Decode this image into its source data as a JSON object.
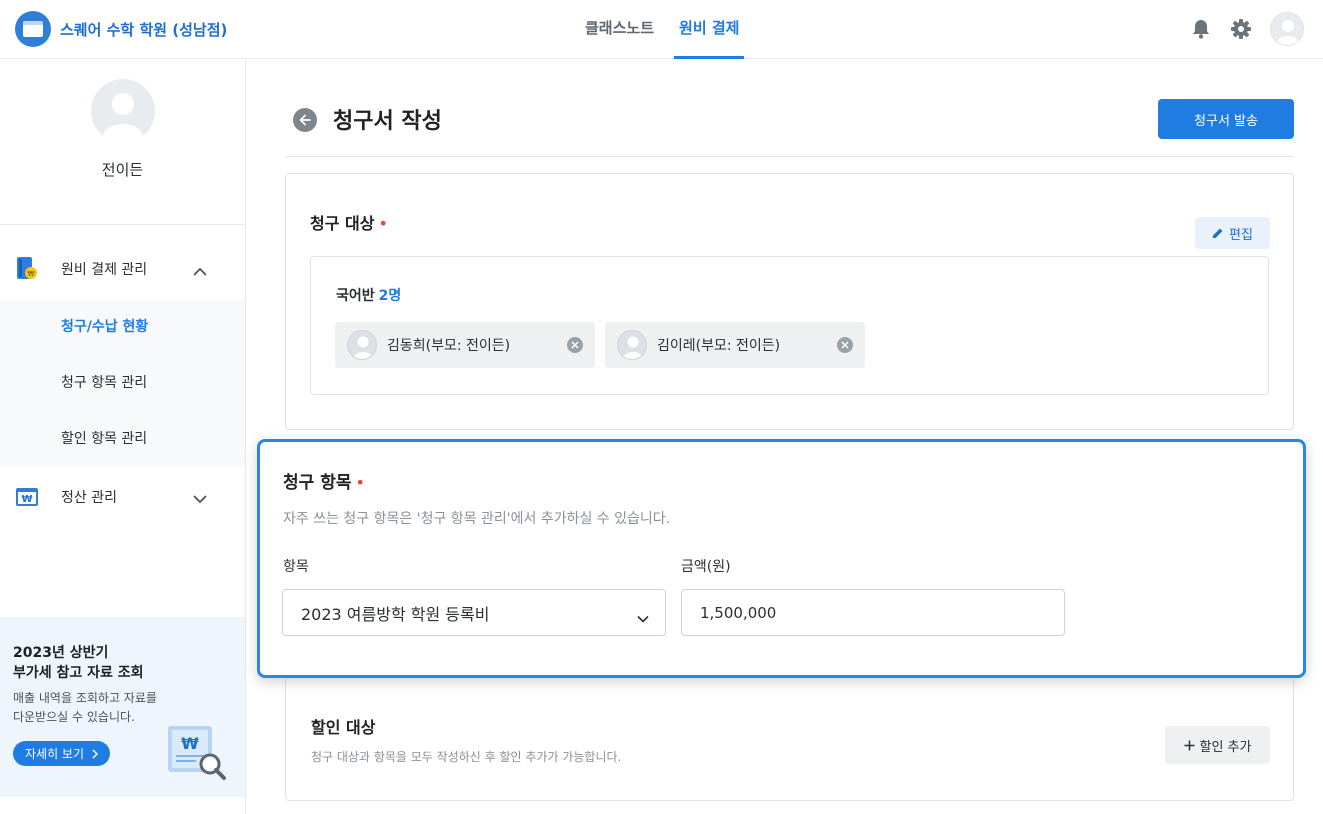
{
  "header": {
    "brand_name": "스퀘어 수학 학원 (성남점)",
    "tabs": [
      {
        "label": "클래스노트",
        "active": false
      },
      {
        "label": "원비 결제",
        "active": true
      }
    ],
    "icons": [
      "bell-icon",
      "gear-icon",
      "avatar"
    ]
  },
  "sidebar": {
    "user_name": "전이든",
    "menu": [
      {
        "label": "원비 결제 관리",
        "icon": "payment-book-icon",
        "expanded": true,
        "children": [
          {
            "label": "청구/수납 현황",
            "active": true
          },
          {
            "label": "청구 항목 관리",
            "active": false
          },
          {
            "label": "할인 항목 관리",
            "active": false
          }
        ]
      },
      {
        "label": "정산 관리",
        "icon": "settlement-icon",
        "expanded": false
      }
    ],
    "promo": {
      "title_line1": "2023년 상반기",
      "title_line2": "부가세 참고 자료 조회",
      "desc_line1": "매출 내역을 조회하고 자료를",
      "desc_line2": "다운받으실 수 있습니다.",
      "button": "자세히 보기"
    }
  },
  "page": {
    "title": "청구서 작성",
    "send_button": "청구서 발송"
  },
  "target_section": {
    "title": "청구 대상",
    "required_mark": "•",
    "edit_button": "편집",
    "class_name": "국어반",
    "class_count": "2명",
    "students": [
      {
        "name": "김동희(부모: 전이든)"
      },
      {
        "name": "김이레(부모: 전이든)"
      }
    ]
  },
  "items_section": {
    "title": "청구 항목",
    "required_mark": "•",
    "description": "자주 쓰는 청구 항목은 '청구 항목 관리'에서 추가하실 수 있습니다.",
    "item_label": "항목",
    "item_value": "2023 여름방학 학원 등록비",
    "amount_label": "금액(원)",
    "amount_value": "1,500,000"
  },
  "discount_section": {
    "title": "할인 대상",
    "description": "청구 대상과 항목을 모두 작성하신 후 할인 추가가 가능합니다.",
    "add_button": "할인 추가"
  },
  "colors": {
    "accent": "#1f7ce0",
    "required": "#e8452c",
    "chip_bg": "#eef0f2"
  }
}
